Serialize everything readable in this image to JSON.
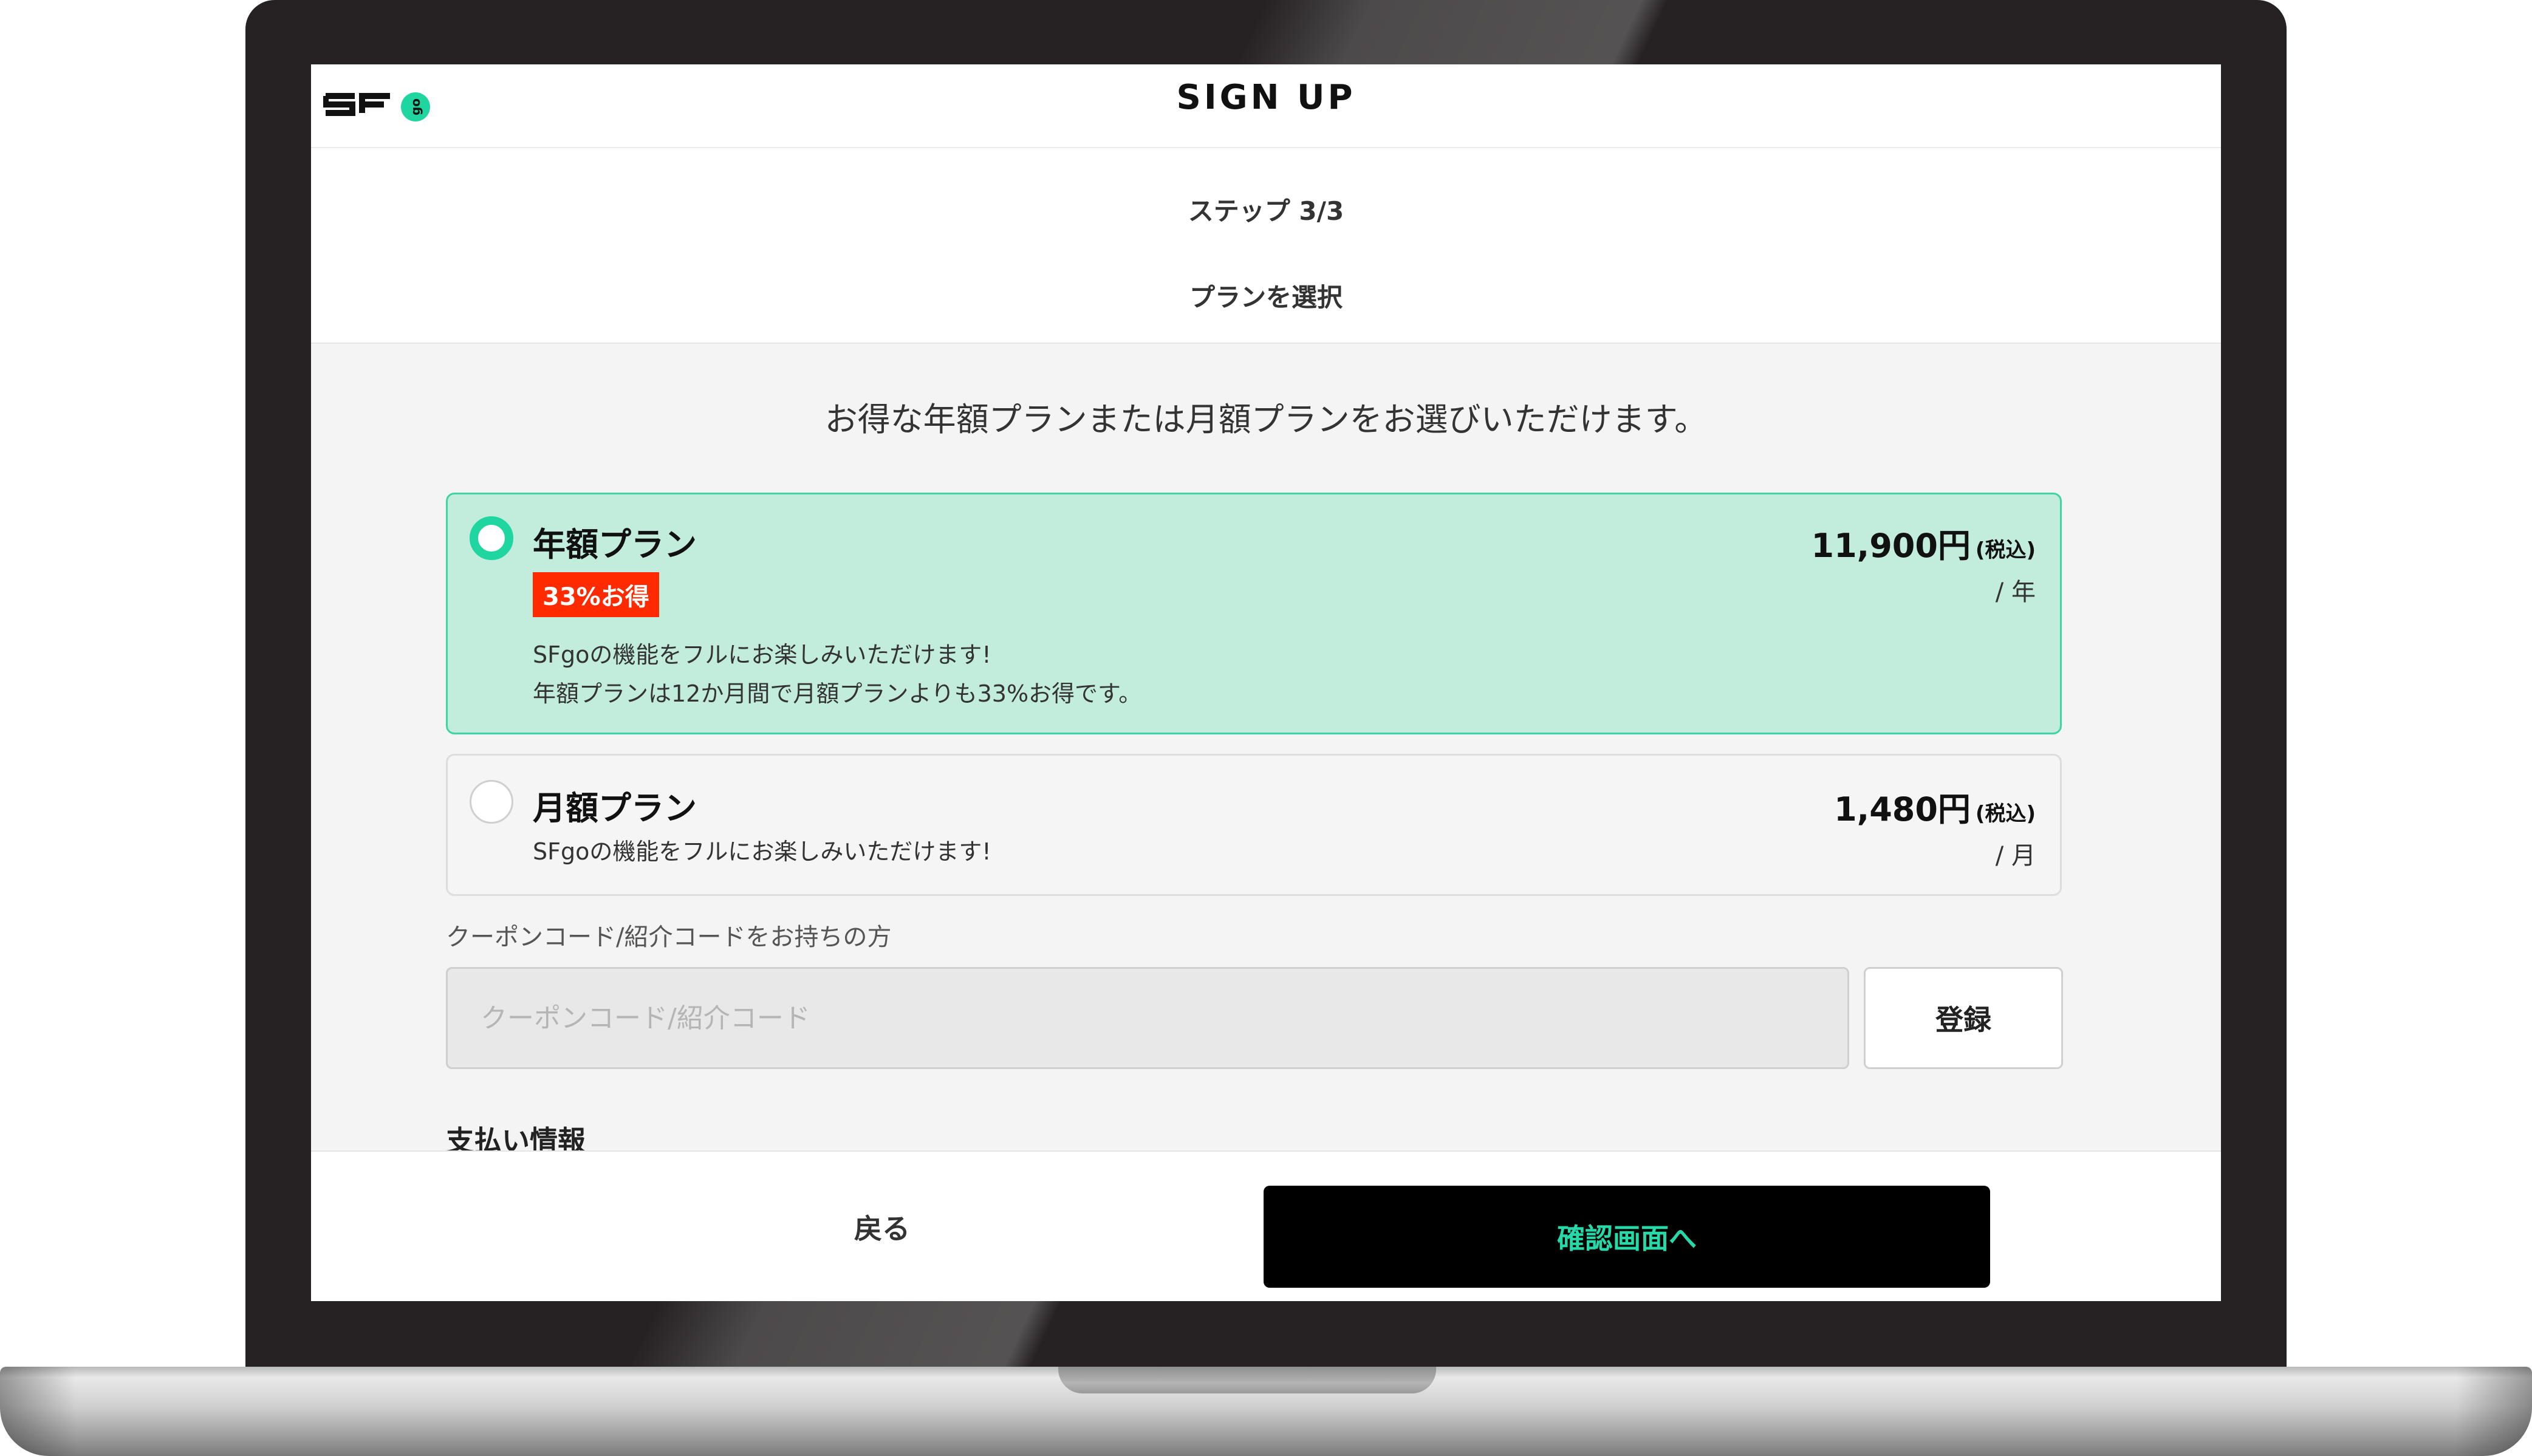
{
  "header": {
    "logo_text": "SFgo",
    "title": "SIGN UP"
  },
  "steps": {
    "step": "ステップ 3/3",
    "subtitle": "プランを選択"
  },
  "lead": "お得な年額プランまたは月額プランをお選びいただけます。",
  "plans": [
    {
      "name": "年額プラン",
      "badge": "33%お得",
      "description_1": "SFgoの機能をフルにお楽しみいただけます!",
      "description_2": "年額プランは12か月間で月額プランよりも33%お得です。",
      "price": "11,900円",
      "tax": "(税込)",
      "per": "/ 年",
      "selected": true
    },
    {
      "name": "月額プラン",
      "description_1": "SFgoの機能をフルにお楽しみいただけます!",
      "price": "1,480円",
      "tax": "(税込)",
      "per": "/ 月",
      "selected": false
    }
  ],
  "coupon": {
    "label": "クーポンコード/紹介コードをお持ちの方",
    "placeholder": "クーポンコード/紹介コード",
    "value": "",
    "register_label": "登録"
  },
  "payment": {
    "heading": "支払い情報"
  },
  "footer": {
    "back_label": "戻る",
    "confirm_label": "確認画面へ"
  },
  "colors": {
    "accent": "#1fd6a0",
    "selected_bg": "#c2ecdc",
    "badge": "#ff2a00",
    "confirm_bg": "#000000"
  }
}
